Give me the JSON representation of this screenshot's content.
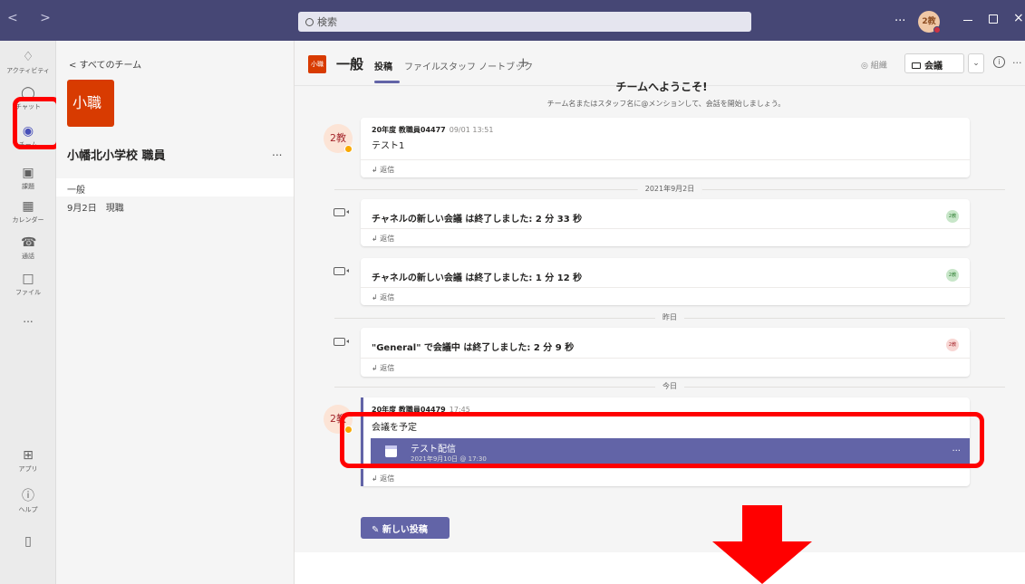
{
  "titlebar": {
    "nav_arrows": "< >",
    "search_placeholder": "検索",
    "more": "...",
    "avatar": "2教",
    "close": "×"
  },
  "rail": [
    {
      "label": "アクティビティ",
      "icon": "bell-icon"
    },
    {
      "label": "チャット",
      "icon": "chat-icon"
    },
    {
      "label": "チーム",
      "icon": "teams-icon"
    },
    {
      "label": "課題",
      "icon": "assignments-icon"
    },
    {
      "label": "カレンダー",
      "icon": "calendar-icon"
    },
    {
      "label": "通話",
      "icon": "phone-icon"
    },
    {
      "label": "ファイル",
      "icon": "file-icon"
    },
    {
      "label": "...",
      "icon": "more-icon"
    },
    {
      "label": "アプリ",
      "icon": "apps-icon"
    },
    {
      "label": "ヘルプ",
      "icon": "help-icon"
    }
  ],
  "team": {
    "back_link": "< すべてのチーム",
    "avatar": "小職",
    "name": "小幡北小学校 職員",
    "more": "...",
    "channels": [
      "一般",
      "9月2日　現職"
    ]
  },
  "header": {
    "avatar": "小職",
    "channel": "一般",
    "tabs": [
      "投稿",
      "ファイル",
      "スタッフ ノートブック"
    ],
    "add": "+",
    "org": "組織",
    "meet": "会議",
    "info": "i",
    "more": "..."
  },
  "feed": {
    "welcome_title": "チームへようこそ!",
    "welcome_sub": "チーム名またはスタッフ名に@メンションして、会話を開始しましょう。",
    "reply": "返信",
    "post1": {
      "avatar": "2教",
      "sender": "20年度 教職員04477",
      "time": "09/01 13:51",
      "body": "テスト1"
    },
    "dividers": [
      "2021年9月2日",
      "昨日",
      "今日"
    ],
    "meetings": [
      {
        "text": "チャネルの新しい会議 は終了しました: 2 分 33 秒",
        "avatar": "2教"
      },
      {
        "text": "チャネルの新しい会議 は終了しました: 1 分 12 秒",
        "avatar": "2教"
      },
      {
        "text": "\"General\" で会議中 は終了しました: 2 分 9 秒",
        "avatar": "2教"
      }
    ],
    "post2": {
      "avatar": "2教",
      "sender": "20年度 教職員04479",
      "time": "17:45",
      "body": "会議を予定",
      "card_title": "テスト配信",
      "card_date": "2021年9月10日 @ 17:30",
      "card_more": "..."
    },
    "new_post": "新しい投稿"
  },
  "colors": {
    "accent": "#6264a7",
    "titlebar": "#464775",
    "team": "#d83b01",
    "annotation": "#ff0000"
  }
}
